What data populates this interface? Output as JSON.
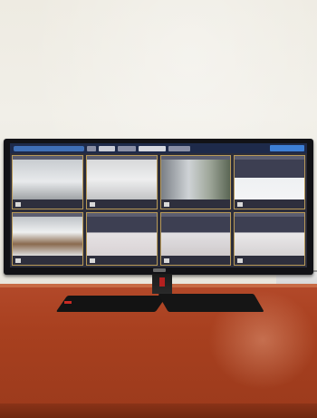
{
  "scene": {
    "wall_color": "#eeebe2",
    "desk_color": "#a8401f",
    "monitor_color": "#121216",
    "accent_color": "#c92a24"
  },
  "monitor": {
    "screen": {
      "taskbar": {
        "search_icon": "search-bar",
        "items": [
          {
            "w": 1
          },
          {
            "w": 2
          },
          {
            "w": 3
          },
          {
            "w": 4
          }
        ],
        "clock_icon": "clock-tray"
      },
      "camera_grid": {
        "rows": 2,
        "columns": 4,
        "cameras": [
          {
            "view": "room-left"
          },
          {
            "view": "corner-ceiling"
          },
          {
            "view": "doorway"
          },
          {
            "view": "ceiling-right"
          },
          {
            "view": "room-floor"
          },
          {
            "view": "ceiling-light"
          },
          {
            "view": "ceiling-fixture"
          },
          {
            "view": "wall-corner"
          }
        ]
      }
    }
  }
}
